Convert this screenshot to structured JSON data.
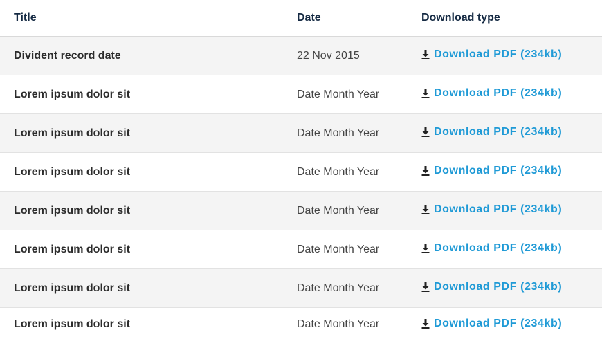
{
  "header": {
    "title": "Title",
    "date": "Date",
    "download_type": "Download type"
  },
  "rows": [
    {
      "title": "Divident record date",
      "date": "22 Nov 2015",
      "download": "Download PDF (234kb)"
    },
    {
      "title": "Lorem ipsum dolor sit",
      "date": "Date Month Year",
      "download": "Download PDF (234kb)"
    },
    {
      "title": "Lorem ipsum dolor sit",
      "date": "Date Month Year",
      "download": "Download PDF (234kb)"
    },
    {
      "title": "Lorem ipsum dolor sit",
      "date": "Date Month Year",
      "download": "Download PDF (234kb)"
    },
    {
      "title": "Lorem ipsum dolor sit",
      "date": "Date Month Year",
      "download": "Download PDF (234kb)"
    },
    {
      "title": "Lorem ipsum dolor sit",
      "date": "Date Month Year",
      "download": "Download PDF (234kb)"
    },
    {
      "title": "Lorem ipsum dolor sit",
      "date": "Date Month Year",
      "download": "Download PDF (234kb)"
    },
    {
      "title": "Lorem ipsum dolor sit",
      "date": "Date Month Year",
      "download": "Download PDF (234kb)"
    }
  ],
  "icons": {
    "download": "download-icon"
  },
  "colors": {
    "header_text": "#152a43",
    "link": "#1f9ad6",
    "row_alt_bg": "#f4f4f4"
  }
}
